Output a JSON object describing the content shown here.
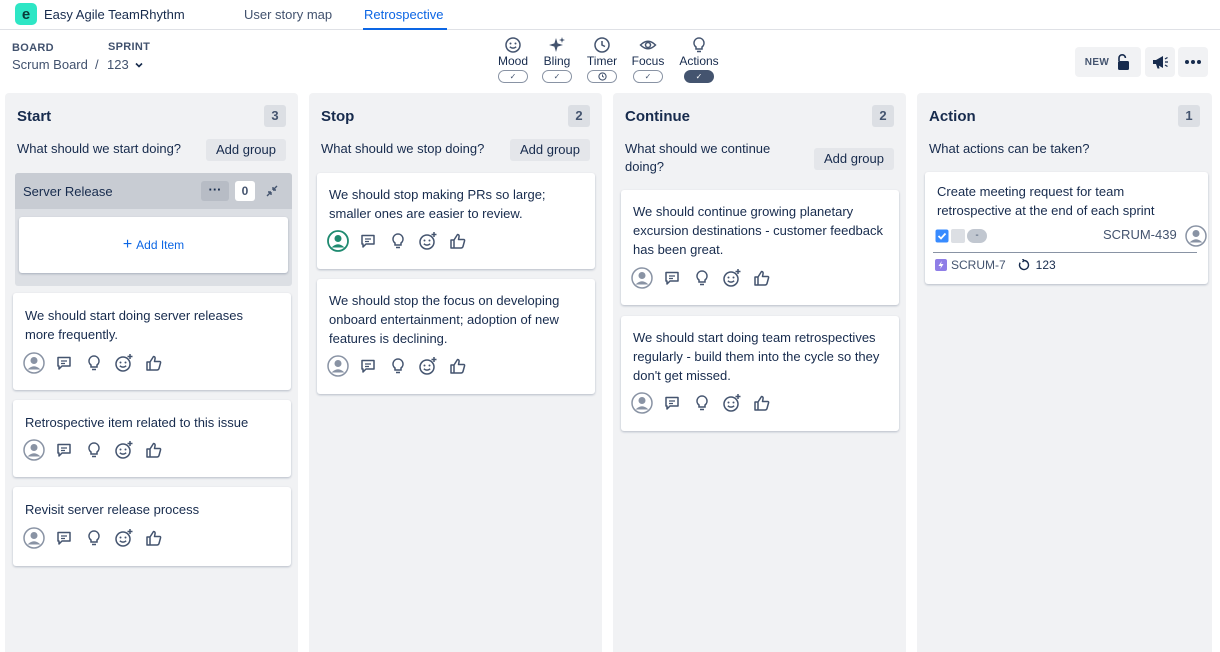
{
  "app": {
    "logo_letter": "e",
    "name": "Easy Agile TeamRhythm"
  },
  "nav": {
    "tabs": [
      {
        "label": "User story map"
      },
      {
        "label": "Retrospective"
      }
    ]
  },
  "header": {
    "board_label": "BOARD",
    "board_value": "Scrum Board",
    "sprint_label": "SPRINT",
    "sprint_value": "123",
    "separator": "/"
  },
  "toolbar": {
    "tools": [
      {
        "label": "Mood",
        "icon": "smiley-icon",
        "state": "check"
      },
      {
        "label": "Bling",
        "icon": "sparkle-icon",
        "state": "check"
      },
      {
        "label": "Timer",
        "icon": "clock-icon",
        "state": "clock"
      },
      {
        "label": "Focus",
        "icon": "eye-icon",
        "state": "check"
      },
      {
        "label": "Actions",
        "icon": "lightbulb-icon",
        "state": "on"
      }
    ],
    "new_badge": "NEW"
  },
  "columns": [
    {
      "title": "Start",
      "count": "3",
      "prompt": "What should we start doing?",
      "add_group": "Add group",
      "group": {
        "title": "Server Release",
        "menu": "···",
        "count": "0",
        "add_item": "Add Item",
        "add_item_prefix": "+"
      },
      "cards": [
        {
          "text": "We should start doing server releases more frequently."
        },
        {
          "text": "Retrospective item related to this issue"
        },
        {
          "text": "Revisit server release process"
        }
      ]
    },
    {
      "title": "Stop",
      "count": "2",
      "prompt": "What should we stop doing?",
      "add_group": "Add group",
      "cards": [
        {
          "text": "We should stop making PRs so large; smaller ones are easier to review."
        },
        {
          "text": "We should stop the focus on developing onboard entertainment; adoption of new features is declining."
        }
      ]
    },
    {
      "title": "Continue",
      "count": "2",
      "prompt": "What should we continue doing?",
      "add_group": "Add group",
      "cards": [
        {
          "text": "We should continue growing planetary excursion destinations - customer feedback has been great."
        },
        {
          "text": "We should start doing team retrospectives regularly - build them into the cycle so they don't get missed."
        }
      ]
    },
    {
      "title": "Action",
      "count": "1",
      "prompt": "What actions can be taken?",
      "cards": [
        {
          "text": "Create meeting request for team retrospective at the end of each sprint",
          "status_pill": "-",
          "issue_key": "SCRUM-439",
          "parent_key": "SCRUM-7",
          "sprint": "123"
        }
      ]
    }
  ],
  "colors": {
    "accent": "#0c66e4",
    "column_bg": "#f1f2f4",
    "teal_avatar": "#1f8a70",
    "logo": "#2ee6c5"
  }
}
